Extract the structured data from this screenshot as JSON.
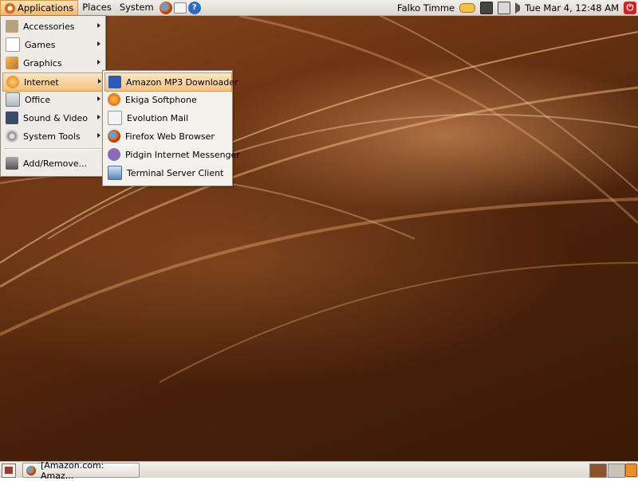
{
  "top_panel": {
    "applications_label": "Applications",
    "places_label": "Places",
    "system_label": "System",
    "launchers": [
      "firefox-icon",
      "mail-icon",
      "help-icon"
    ],
    "help_glyph": "?",
    "user_name": "Falko Timme",
    "clock": "Tue Mar  4, 12:48 AM",
    "shutdown_glyph": "⏻"
  },
  "applications_menu": {
    "items": [
      {
        "label": "Accessories",
        "icon": "accessories-icon",
        "has_submenu": true
      },
      {
        "label": "Games",
        "icon": "games-icon",
        "has_submenu": true
      },
      {
        "label": "Graphics",
        "icon": "graphics-icon",
        "has_submenu": true
      },
      {
        "label": "Internet",
        "icon": "internet-icon",
        "has_submenu": true,
        "highlighted": true
      },
      {
        "label": "Office",
        "icon": "office-icon",
        "has_submenu": true
      },
      {
        "label": "Sound & Video",
        "icon": "sound-video-icon",
        "has_submenu": true
      },
      {
        "label": "System Tools",
        "icon": "system-tools-icon",
        "has_submenu": true
      },
      {
        "label": "Add/Remove...",
        "icon": "add-remove-icon",
        "has_submenu": false
      }
    ]
  },
  "internet_submenu": {
    "items": [
      {
        "label": "Amazon MP3 Downloader",
        "icon": "amazon-icon",
        "highlighted": true
      },
      {
        "label": "Ekiga Softphone",
        "icon": "ekiga-icon"
      },
      {
        "label": "Evolution Mail",
        "icon": "evolution-icon"
      },
      {
        "label": "Firefox Web Browser",
        "icon": "firefox-icon"
      },
      {
        "label": "Pidgin Internet Messenger",
        "icon": "pidgin-icon"
      },
      {
        "label": "Terminal Server Client",
        "icon": "terminal-server-icon"
      }
    ]
  },
  "bottom_panel": {
    "taskbar_window_label": "[Amazon.com: Amaz..."
  },
  "colors": {
    "highlight": "#f4c27e",
    "panel": "#e8e5de",
    "wallpaper": "#6b3312"
  }
}
